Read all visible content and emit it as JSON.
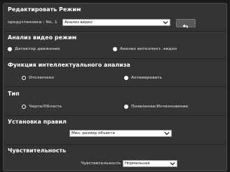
{
  "header": {
    "title": "Редактировать Режим"
  },
  "presets": {
    "label": "предустановки : No. 1",
    "selected": "Анализ видео"
  },
  "analysis_mode": {
    "title": "Анализ видео режим",
    "options": [
      "Детектор движения",
      "Анализ интеллект. видео"
    ],
    "selected_index": 1
  },
  "intelligent_function": {
    "title": "Функция интеллектуального анализа",
    "options": [
      "Отключено",
      "Активировать"
    ],
    "selected_index": 0
  },
  "type": {
    "title": "Тип",
    "options": [
      "Черта/Область",
      "Появление/Исчезновение"
    ],
    "selected_index": 0
  },
  "rules": {
    "title": "Установка правил",
    "selected": "Мин. размер объекта"
  },
  "sensitivity": {
    "title": "Чувствительность",
    "label": "Чувствительность",
    "selected": "Нормальная"
  },
  "icons": {
    "chevron": "chevron-down-icon",
    "undo": "undo-arrow-icon"
  }
}
